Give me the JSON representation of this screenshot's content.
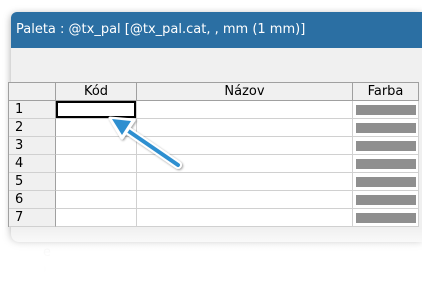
{
  "window": {
    "title": "Paleta : @tx_pal  [@tx_pal.cat, , mm (1 mm)]"
  },
  "grid": {
    "columns": [
      "",
      "Kód",
      "Názov",
      "Farba"
    ],
    "rows": [
      {
        "num": "1",
        "kod": "",
        "nazov": ""
      },
      {
        "num": "2",
        "kod": "",
        "nazov": ""
      },
      {
        "num": "3",
        "kod": "",
        "nazov": ""
      },
      {
        "num": "4",
        "kod": "",
        "nazov": ""
      },
      {
        "num": "5",
        "kod": "",
        "nazov": ""
      },
      {
        "num": "6",
        "kod": "",
        "nazov": ""
      },
      {
        "num": "7",
        "kod": "",
        "nazov": ""
      }
    ],
    "swatch_color": "#8f8f8f"
  },
  "colors": {
    "titlebar": "#2b6fa3",
    "arrow": "#2f8fd0"
  }
}
